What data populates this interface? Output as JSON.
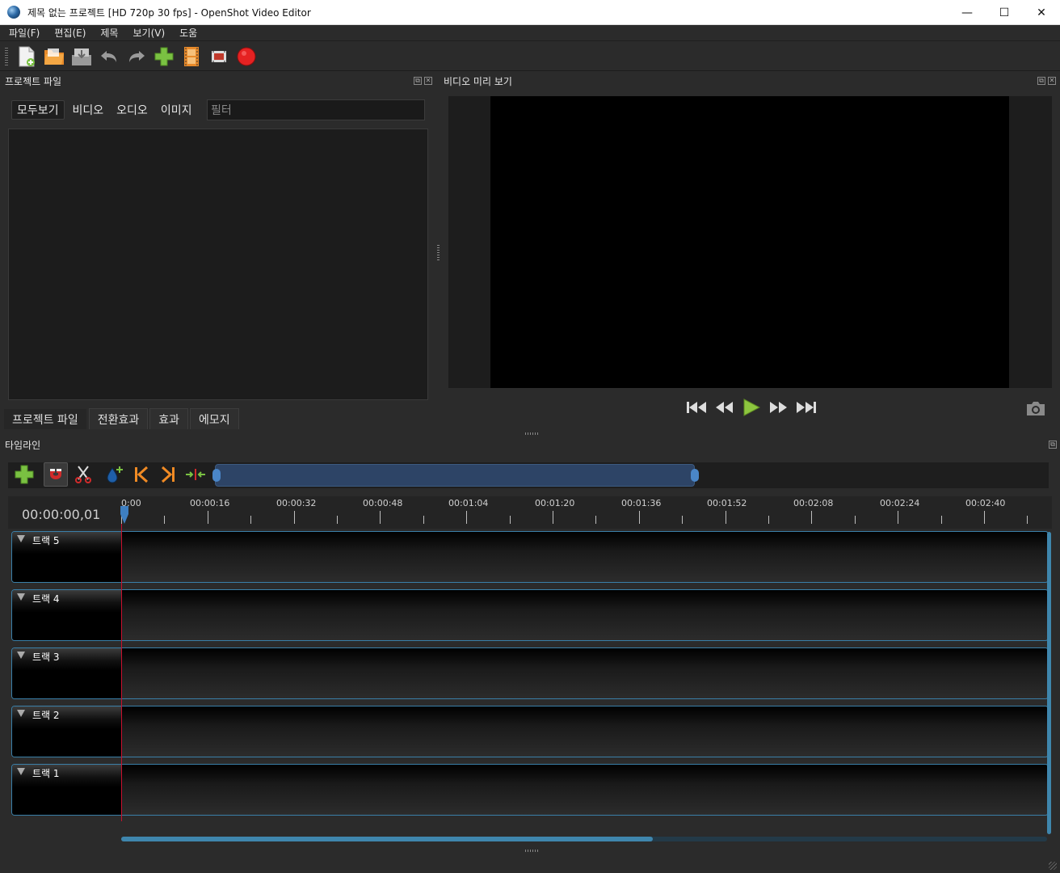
{
  "window": {
    "title": "제목 없는 프로젝트 [HD 720p 30 fps] - OpenShot Video Editor",
    "minimize": "—",
    "maximize": "☐",
    "close": "✕"
  },
  "menu": {
    "items": [
      "파일(F)",
      "편집(E)",
      "제목",
      "보기(V)",
      "도움"
    ]
  },
  "toolbar": {
    "icons": [
      "new-project-icon",
      "open-project-icon",
      "save-project-icon",
      "undo-icon",
      "redo-icon",
      "import-files-icon",
      "profile-icon",
      "fullscreen-icon",
      "export-record-icon"
    ]
  },
  "project_files": {
    "title": "프로젝트 파일",
    "filters": [
      "모두보기",
      "비디오",
      "오디오",
      "이미지"
    ],
    "filter_placeholder": "필터",
    "bottom_tabs": [
      "프로젝트 파일",
      "전환효과",
      "효과",
      "에모지"
    ]
  },
  "video_preview": {
    "title": "비디오 미리 보기"
  },
  "timeline": {
    "title": "타임라인",
    "current_time": "00:00:00,01",
    "ruler_labels": [
      "0:00",
      "00:00:16",
      "00:00:32",
      "00:00:48",
      "00:01:04",
      "00:01:20",
      "00:01:36",
      "00:01:52",
      "00:02:08",
      "00:02:24",
      "00:02:40"
    ],
    "tracks": [
      "트랙 5",
      "트랙 4",
      "트랙 3",
      "트랙 2",
      "트랙 1"
    ]
  },
  "colors": {
    "accent": "#3f86ad",
    "playhead": "#c8102e",
    "background": "#2b2b2b"
  }
}
